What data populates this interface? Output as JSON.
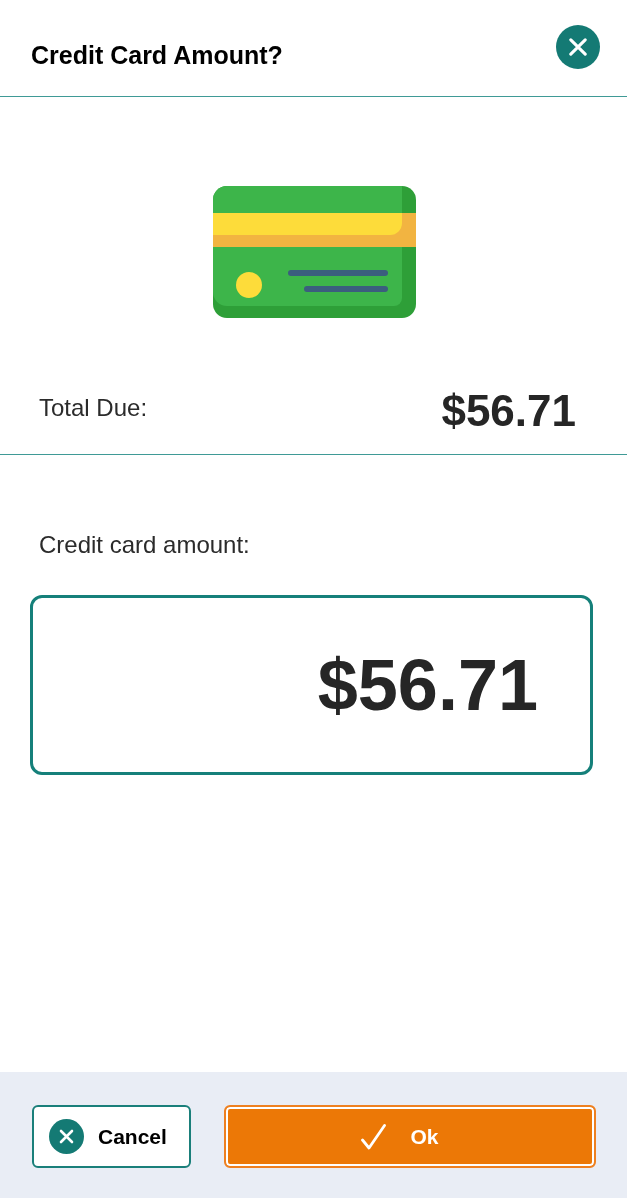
{
  "dialog": {
    "title": "Credit Card Amount?"
  },
  "total_due": {
    "label": "Total Due:",
    "amount": "$56.71"
  },
  "amount_field": {
    "label": "Credit card amount:",
    "value": "$56.71"
  },
  "buttons": [
    {
      "label": "Cancel",
      "kind": "cancel"
    },
    {
      "label": "Ok",
      "kind": "confirm"
    }
  ]
}
